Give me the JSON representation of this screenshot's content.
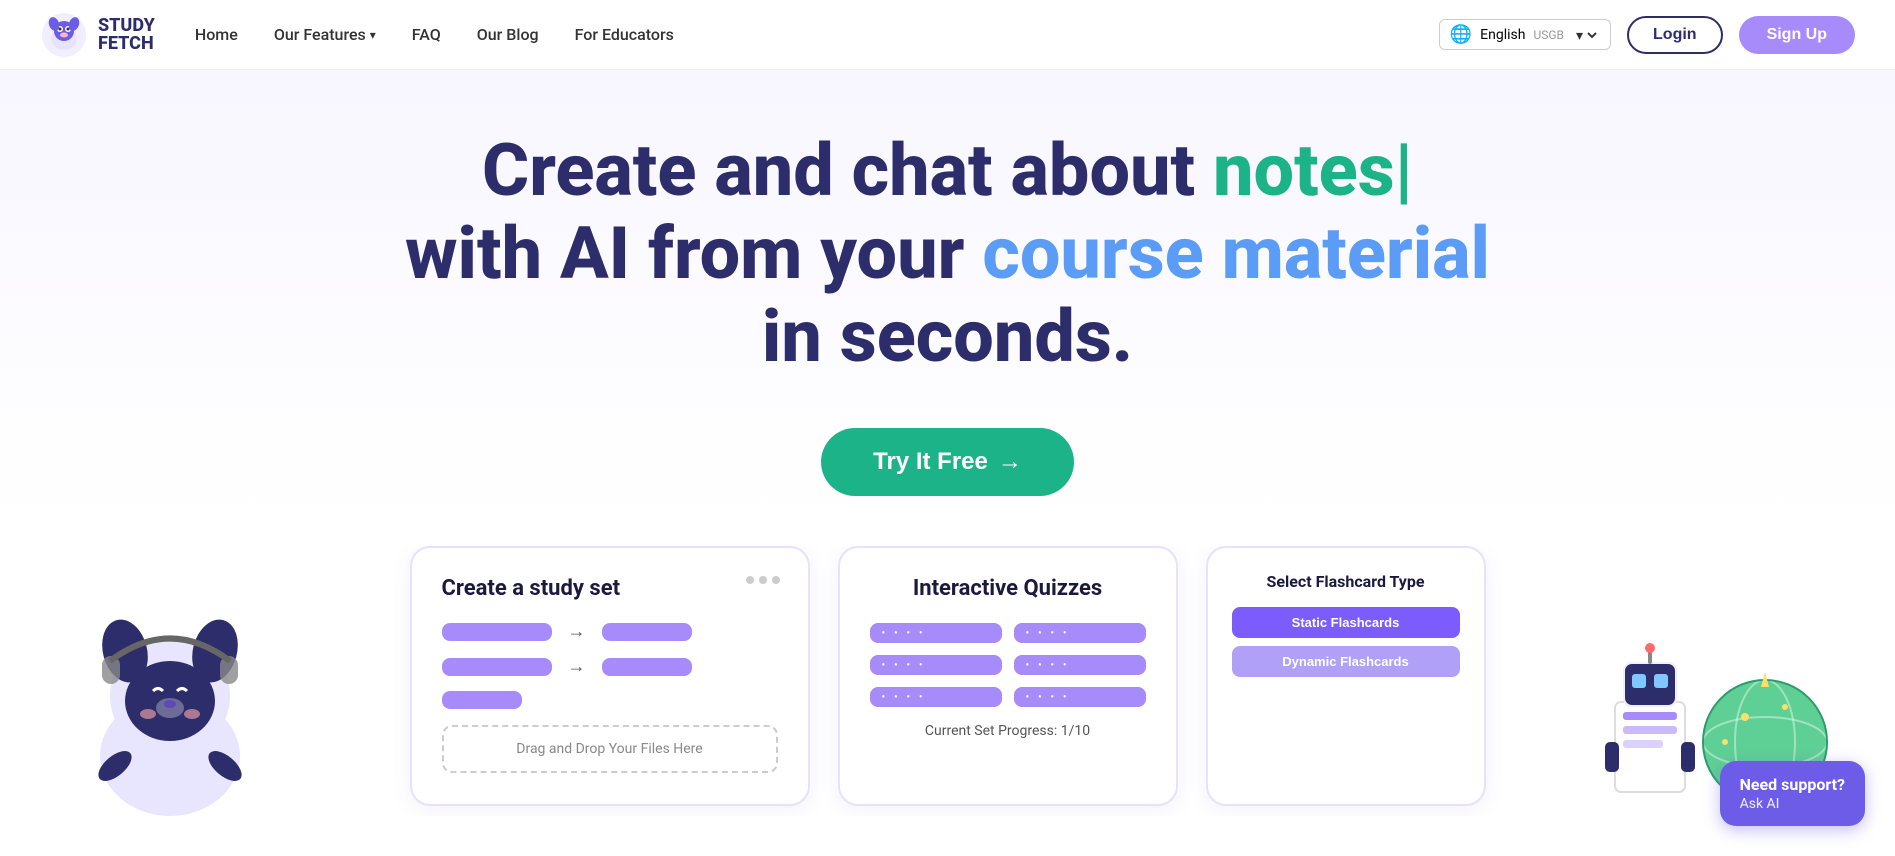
{
  "brand": {
    "name_top": "STUDY",
    "name_bottom": "FETCH"
  },
  "navbar": {
    "home": "Home",
    "features": "Our Features",
    "faq": "FAQ",
    "blog": "Our Blog",
    "educators": "For Educators",
    "language_label": "English",
    "language_code": "USGB",
    "login_label": "Login",
    "signup_label": "Sign Up"
  },
  "hero": {
    "title_part1": "Create and chat about ",
    "title_highlight_green": "notes|",
    "title_part2": " with AI from your ",
    "title_highlight_blue": "course material",
    "title_part3": " in seconds."
  },
  "cta": {
    "label": "Try It Free",
    "arrow": "→"
  },
  "card_study_set": {
    "title": "Create a study set",
    "drag_drop_text": "Drag and Drop Your Files Here",
    "dots": [
      "•",
      "•",
      "•"
    ]
  },
  "card_quiz": {
    "title": "Interactive Quizzes",
    "progress": "Current Set Progress: 1/10"
  },
  "card_flashcard": {
    "header": "Select Flashcard Type",
    "btn_static": "Static Flashcards",
    "btn_dynamic": "Dynamic Flashcards"
  },
  "support": {
    "title": "Need support?",
    "subtitle": "Ask AI"
  }
}
